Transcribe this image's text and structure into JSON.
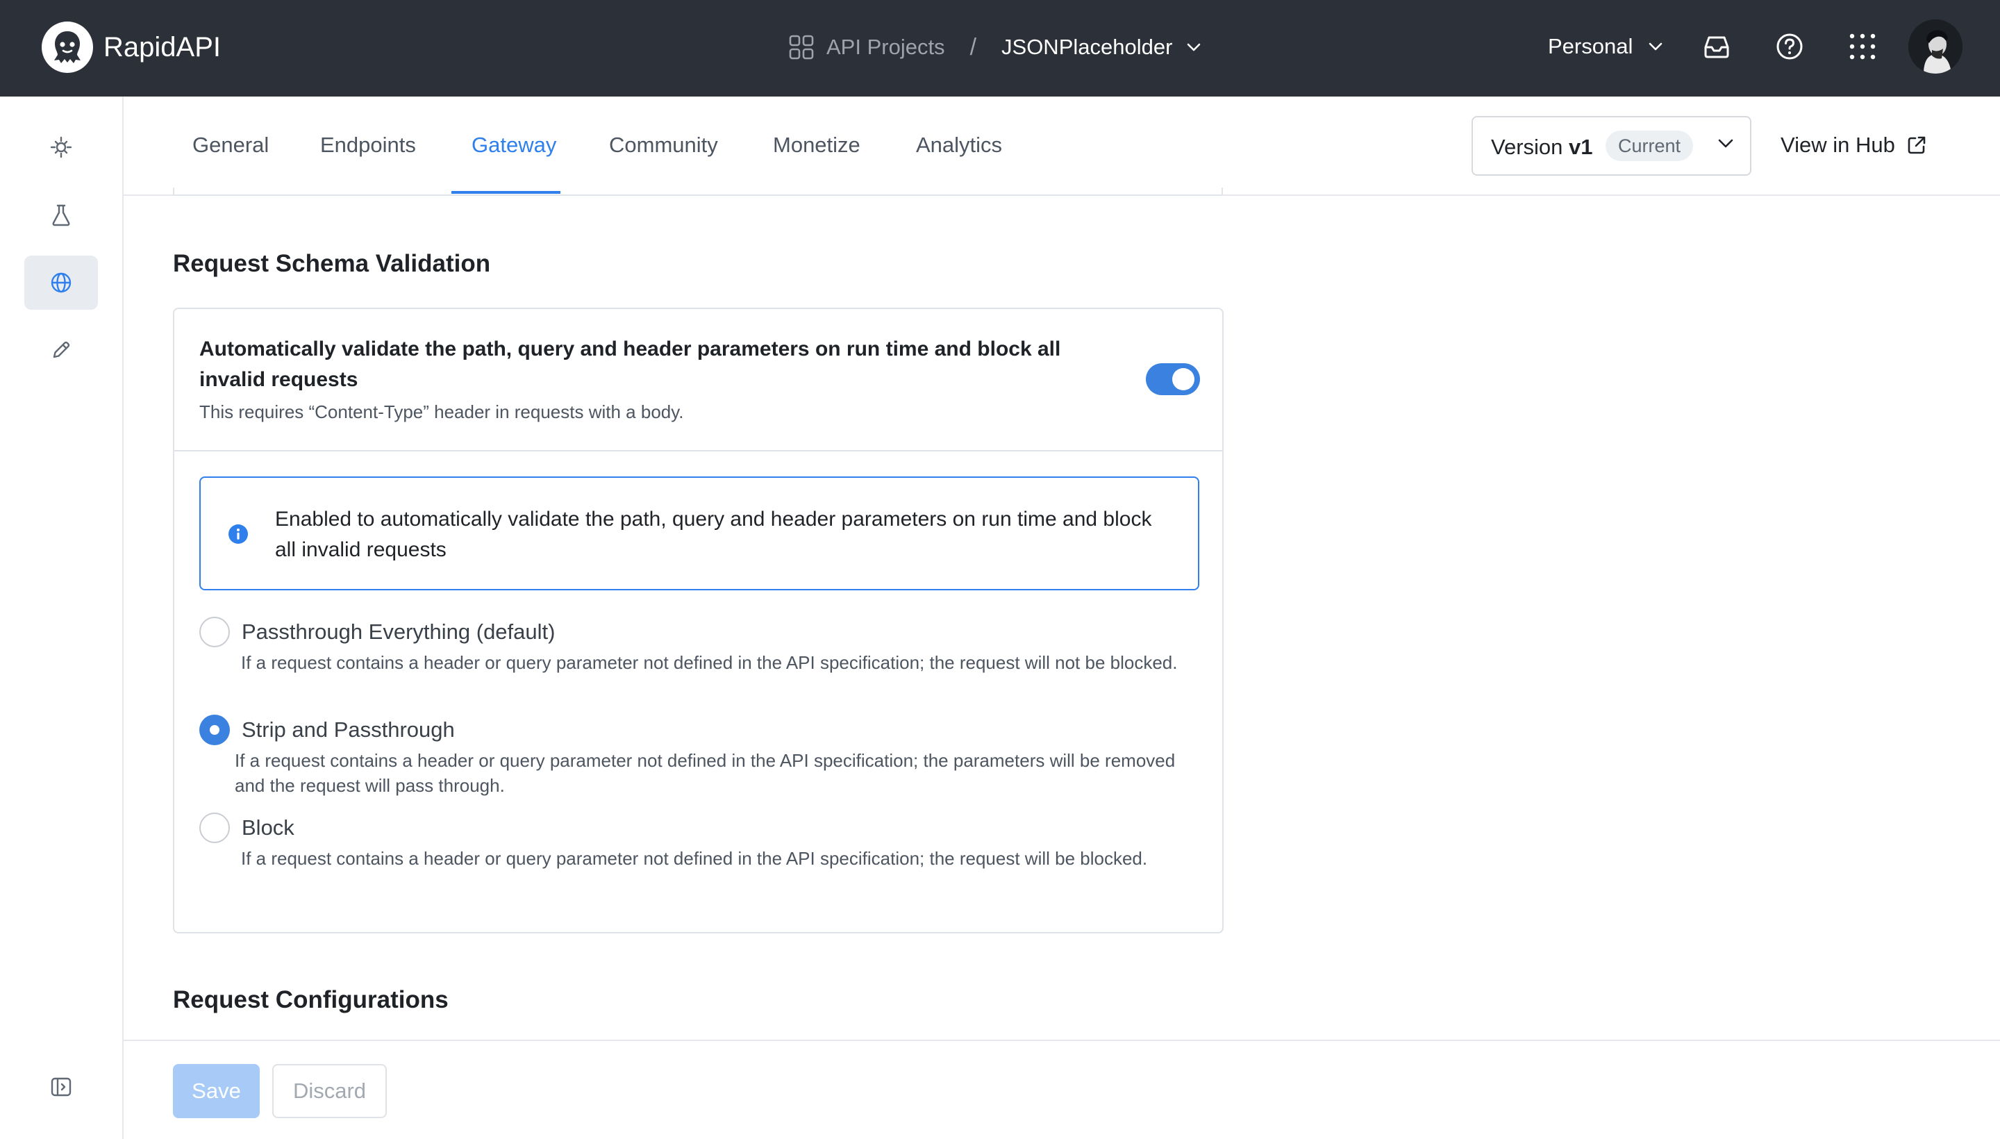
{
  "header": {
    "brand": "RapidAPI",
    "breadcrumb_projects": "API Projects",
    "breadcrumb_separator": "/",
    "breadcrumb_api": "JSONPlaceholder",
    "workspace": "Personal",
    "icons": [
      "inbox-icon",
      "help-icon",
      "apps-grid-icon"
    ]
  },
  "sidebar": {
    "items": [
      {
        "icon": "hub-icon",
        "active": false
      },
      {
        "icon": "flask-icon",
        "active": false
      },
      {
        "icon": "globe-icon",
        "active": true
      },
      {
        "icon": "pencil-icon",
        "active": false
      }
    ],
    "bottom_icon": "collapse-sidebar-icon"
  },
  "tabs": [
    {
      "label": "General",
      "active": false
    },
    {
      "label": "Endpoints",
      "active": false
    },
    {
      "label": "Gateway",
      "active": true
    },
    {
      "label": "Community",
      "active": false
    },
    {
      "label": "Monetize",
      "active": false
    },
    {
      "label": "Analytics",
      "active": false
    }
  ],
  "version": {
    "prefix": "Version",
    "value": "v1",
    "badge": "Current"
  },
  "view_in_hub": "View in Hub",
  "schema_validation": {
    "title": "Request Schema Validation",
    "heading": "Automatically validate the path, query and header parameters on run time and block all invalid requests",
    "subtext": "This requires “Content-Type” header in requests with a body.",
    "toggle_on": true,
    "info_text": "Enabled to automatically validate the path, query and header parameters on run time and block all invalid requests",
    "options": [
      {
        "label": "Passthrough Everything (default)",
        "description": "If a request contains a header or query parameter not defined in the API specification; the request will not be blocked.",
        "checked": false
      },
      {
        "label": "Strip and Passthrough",
        "description": "If a request contains a header or query parameter not defined in the API specification; the parameters will be removed and the request will pass through.",
        "checked": true
      },
      {
        "label": "Block",
        "description": "If a request contains a header or query parameter not defined in the API specification; the request will be blocked.",
        "checked": false
      }
    ]
  },
  "request_config": {
    "title": "Request Configurations"
  },
  "footer": {
    "save": "Save",
    "discard": "Discard"
  },
  "colors": {
    "header_bg": "#2c3038",
    "accent": "#2f80ed",
    "toggle": "#3b82e0",
    "save_disabled": "#a7cbf6"
  }
}
